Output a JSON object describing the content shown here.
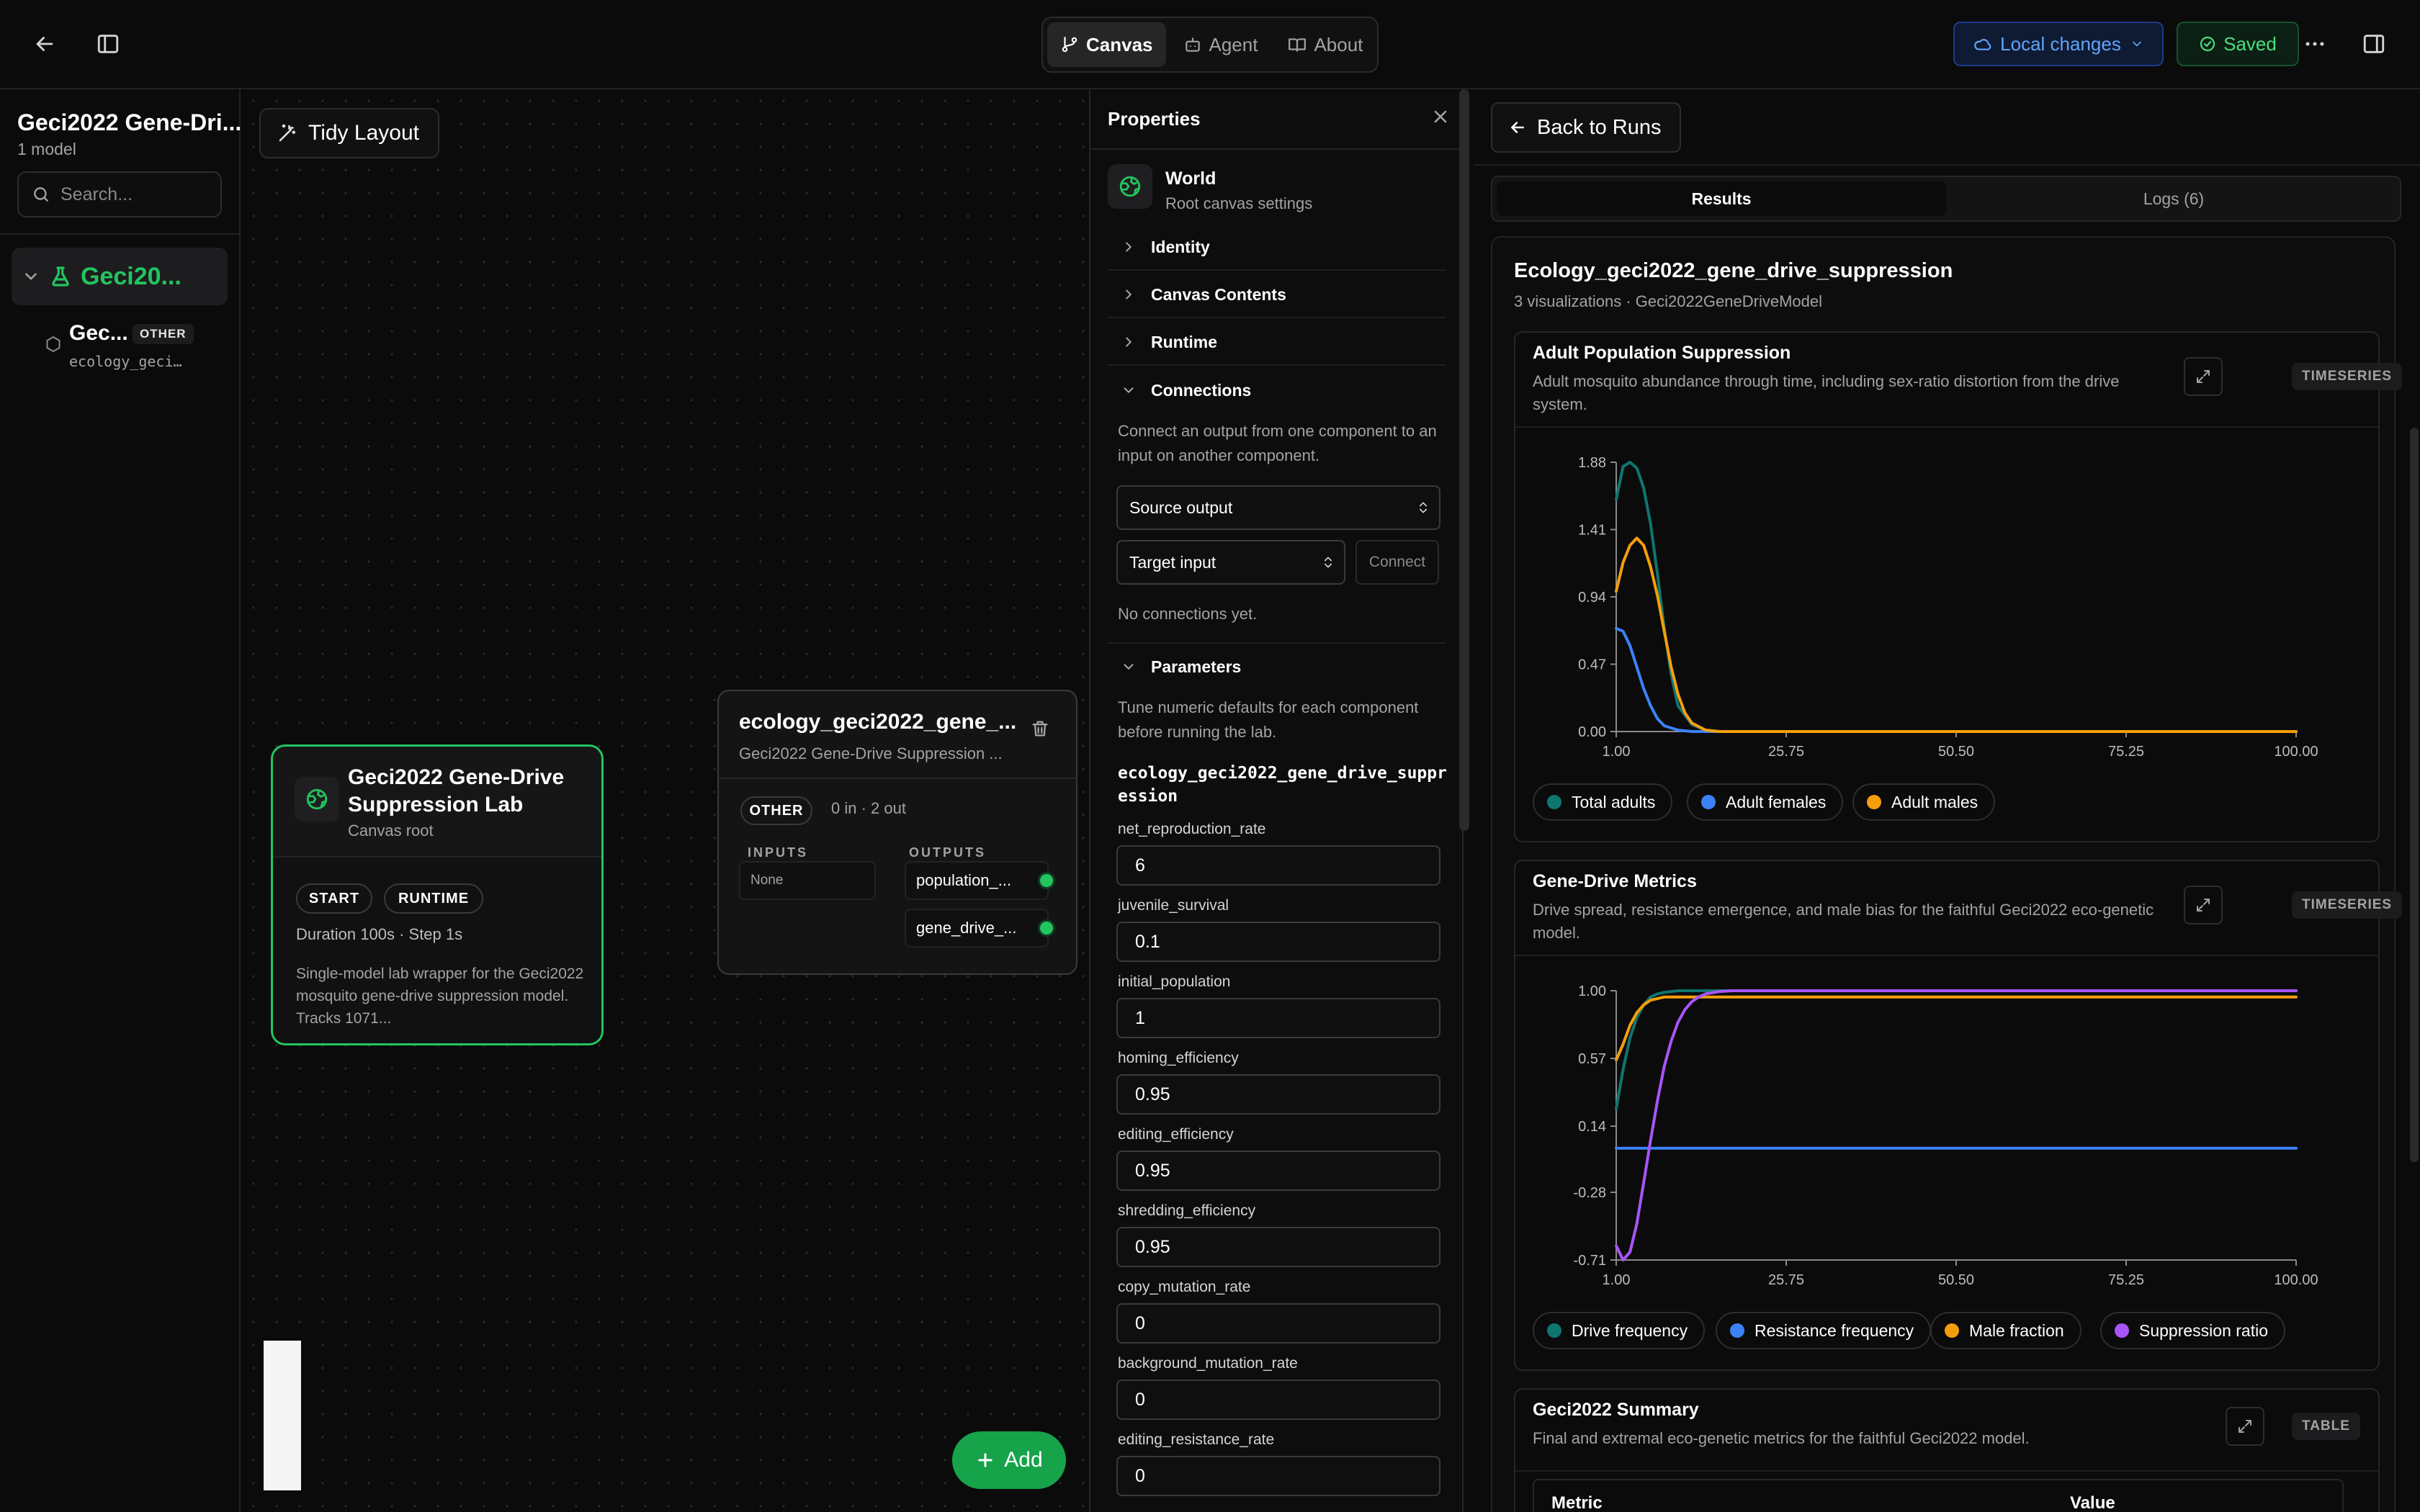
{
  "topbar": {
    "tabs": [
      {
        "label": "Canvas",
        "icon": "git-branch-icon",
        "active": true
      },
      {
        "label": "Agent",
        "icon": "bot-icon",
        "active": false
      },
      {
        "label": "About",
        "icon": "book-icon",
        "active": false
      }
    ],
    "local_changes": "Local changes",
    "saved": "Saved",
    "colors": {
      "accent_green": "#22c55e",
      "accent_blue": "#60a5fa"
    }
  },
  "sidebar": {
    "title": "Geci2022 Gene-Dri...",
    "subtitle": "1 model",
    "search_placeholder": "Search...",
    "group_label": "Geci20...",
    "item": {
      "name": "Gec...",
      "badge": "OTHER",
      "sub": "ecology_geci…"
    }
  },
  "canvas": {
    "tidy_layout": "Tidy Layout",
    "lab_node": {
      "title": "Geci2022 Gene-Drive Suppression Lab",
      "subtitle": "Canvas root",
      "tags": [
        "START",
        "RUNTIME"
      ],
      "duration": "Duration 100s · Step 1s",
      "description": "Single-model lab wrapper for the Geci2022 mosquito gene-drive suppression model. Tracks 1071..."
    },
    "model_node": {
      "title": "ecology_geci2022_gene_...",
      "subtitle": "Geci2022 Gene-Drive Suppression ...",
      "tag": "OTHER",
      "io_count": "0 in · 2 out",
      "inputs_label": "INPUTS",
      "outputs_label": "OUTPUTS",
      "inputs_none": "None",
      "outputs": [
        "population_...",
        "gene_drive_..."
      ]
    },
    "add_button": "Add"
  },
  "properties": {
    "title": "Properties",
    "world_title": "World",
    "world_sub": "Root canvas settings",
    "sections": {
      "identity": "Identity",
      "canvas_contents": "Canvas Contents",
      "runtime": "Runtime",
      "connections": "Connections",
      "parameters": "Parameters"
    },
    "connections_help": "Connect an output from one component to an input on another component.",
    "source_output": "Source output",
    "target_input": "Target input",
    "connect": "Connect",
    "no_connections": "No connections yet.",
    "parameters_help": "Tune numeric defaults for each component before running the lab.",
    "model_id": "ecology_geci2022_gene_drive_suppression",
    "params": [
      {
        "name": "net_reproduction_rate",
        "value": "6"
      },
      {
        "name": "juvenile_survival",
        "value": "0.1"
      },
      {
        "name": "initial_population",
        "value": "1"
      },
      {
        "name": "homing_efficiency",
        "value": "0.95"
      },
      {
        "name": "editing_efficiency",
        "value": "0.95"
      },
      {
        "name": "shredding_efficiency",
        "value": "0.95"
      },
      {
        "name": "copy_mutation_rate",
        "value": "0"
      },
      {
        "name": "background_mutation_rate",
        "value": "0"
      },
      {
        "name": "editing_resistance_rate",
        "value": "0"
      }
    ]
  },
  "results": {
    "back_to_runs": "Back to Runs",
    "tabs": [
      "Results",
      "Logs (6)"
    ],
    "title": "Ecology_geci2022_gene_drive_suppression",
    "subtitle": "3 visualizations · Geci2022GeneDriveModel",
    "viz1": {
      "title": "Adult Population Suppression",
      "description": "Adult mosquito abundance through time, including sex-ratio distortion from the drive system.",
      "kind": "TIMESERIES"
    },
    "viz2": {
      "title": "Gene-Drive Metrics",
      "description": "Drive spread, resistance emergence, and male bias for the faithful Geci2022 eco-genetic model.",
      "kind": "TIMESERIES"
    },
    "viz3": {
      "title": "Geci2022 Summary",
      "description": "Final and extremal eco-genetic metrics for the faithful Geci2022 model.",
      "kind": "TABLE",
      "columns": [
        "Metric",
        "Value"
      ]
    }
  },
  "chart_data": [
    {
      "type": "line",
      "title": "Adult Population Suppression",
      "x_ticks": [
        "1.00",
        "25.75",
        "50.50",
        "75.25",
        "100.00"
      ],
      "y_ticks": [
        "0.00",
        "0.47",
        "0.94",
        "1.41",
        "1.88"
      ],
      "xlim": [
        1,
        100
      ],
      "ylim": [
        0,
        1.88
      ],
      "legend_placement": "bottom",
      "series": [
        {
          "name": "Total adults",
          "color": "#0f766e",
          "x": [
            1,
            2,
            3,
            4,
            5,
            6,
            7,
            8,
            9,
            10,
            12,
            14,
            16,
            20,
            25,
            100
          ],
          "y": [
            1.62,
            1.85,
            1.88,
            1.84,
            1.7,
            1.45,
            1.1,
            0.72,
            0.4,
            0.18,
            0.05,
            0.01,
            0.0,
            0.0,
            0.0,
            0.0
          ]
        },
        {
          "name": "Adult females",
          "color": "#3b82f6",
          "x": [
            1,
            2,
            3,
            4,
            5,
            6,
            7,
            8,
            10,
            12,
            14,
            20,
            100
          ],
          "y": [
            0.72,
            0.7,
            0.6,
            0.45,
            0.3,
            0.18,
            0.09,
            0.04,
            0.01,
            0.0,
            0.0,
            0.0,
            0.0
          ]
        },
        {
          "name": "Adult males",
          "color": "#f59e0b",
          "x": [
            1,
            2,
            3,
            4,
            5,
            6,
            7,
            8,
            9,
            10,
            11,
            12,
            14,
            16,
            20,
            100
          ],
          "y": [
            0.98,
            1.18,
            1.3,
            1.35,
            1.3,
            1.15,
            0.95,
            0.7,
            0.45,
            0.26,
            0.13,
            0.06,
            0.01,
            0.0,
            0.0,
            0.0
          ]
        }
      ]
    },
    {
      "type": "line",
      "title": "Gene-Drive Metrics",
      "x_ticks": [
        "1.00",
        "25.75",
        "50.50",
        "75.25",
        "100.00"
      ],
      "y_ticks": [
        "-0.71",
        "-0.28",
        "0.14",
        "0.57",
        "1.00"
      ],
      "xlim": [
        1,
        100
      ],
      "ylim": [
        -0.71,
        1.0
      ],
      "legend_placement": "bottom",
      "series": [
        {
          "name": "Drive frequency",
          "color": "#0f766e",
          "x": [
            1,
            2,
            3,
            4,
            5,
            6,
            7,
            8,
            10,
            12,
            100
          ],
          "y": [
            0.25,
            0.5,
            0.7,
            0.83,
            0.91,
            0.96,
            0.98,
            0.99,
            1.0,
            1.0,
            1.0
          ]
        },
        {
          "name": "Resistance frequency",
          "color": "#3b82f6",
          "x": [
            1,
            100
          ],
          "y": [
            0.0,
            0.0
          ]
        },
        {
          "name": "Male fraction",
          "color": "#f59e0b",
          "x": [
            1,
            2,
            3,
            4,
            5,
            6,
            7,
            8,
            10,
            14,
            100
          ],
          "y": [
            0.56,
            0.66,
            0.78,
            0.86,
            0.91,
            0.94,
            0.95,
            0.96,
            0.96,
            0.96,
            0.96
          ]
        },
        {
          "name": "Suppression ratio",
          "color": "#a855f7",
          "x": [
            1,
            2,
            3,
            4,
            5,
            6,
            7,
            8,
            9,
            10,
            11,
            12,
            13,
            14,
            16,
            18,
            20,
            25,
            100
          ],
          "y": [
            -0.62,
            -0.71,
            -0.66,
            -0.48,
            -0.22,
            0.05,
            0.3,
            0.52,
            0.68,
            0.8,
            0.88,
            0.93,
            0.96,
            0.98,
            0.995,
            1.0,
            1.0,
            1.0,
            1.0
          ]
        }
      ]
    }
  ]
}
